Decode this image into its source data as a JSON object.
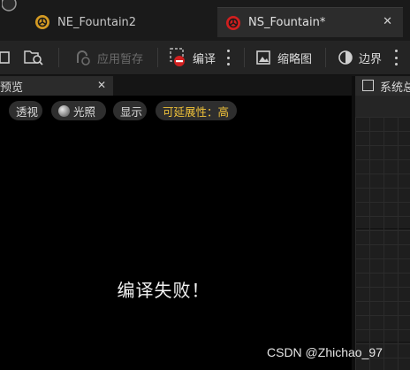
{
  "tabs": [
    {
      "title": "NE_Fountain2",
      "close": ""
    },
    {
      "title": "NS_Fountain*",
      "close": "✕"
    }
  ],
  "toolbar": {
    "apply_label": "应用暂存",
    "compile_label": "编译",
    "thumbnail_label": "缩略图",
    "bounds_label": "边界"
  },
  "preview": {
    "title": "预览",
    "close": "✕",
    "chips": {
      "perspective": "透视",
      "lit": "光照",
      "show": "显示",
      "scalability": "可延展性：高"
    },
    "message": "编译失败！"
  },
  "system_overview": {
    "title": "系统总"
  },
  "watermark": "CSDN @Zhichao_97",
  "colors": {
    "accent_yellow": "#f0c23a",
    "compile_error_red": "#d02020",
    "ne_tab_icon": "#d49a23",
    "ns_tab_icon": "#d01f1f"
  }
}
